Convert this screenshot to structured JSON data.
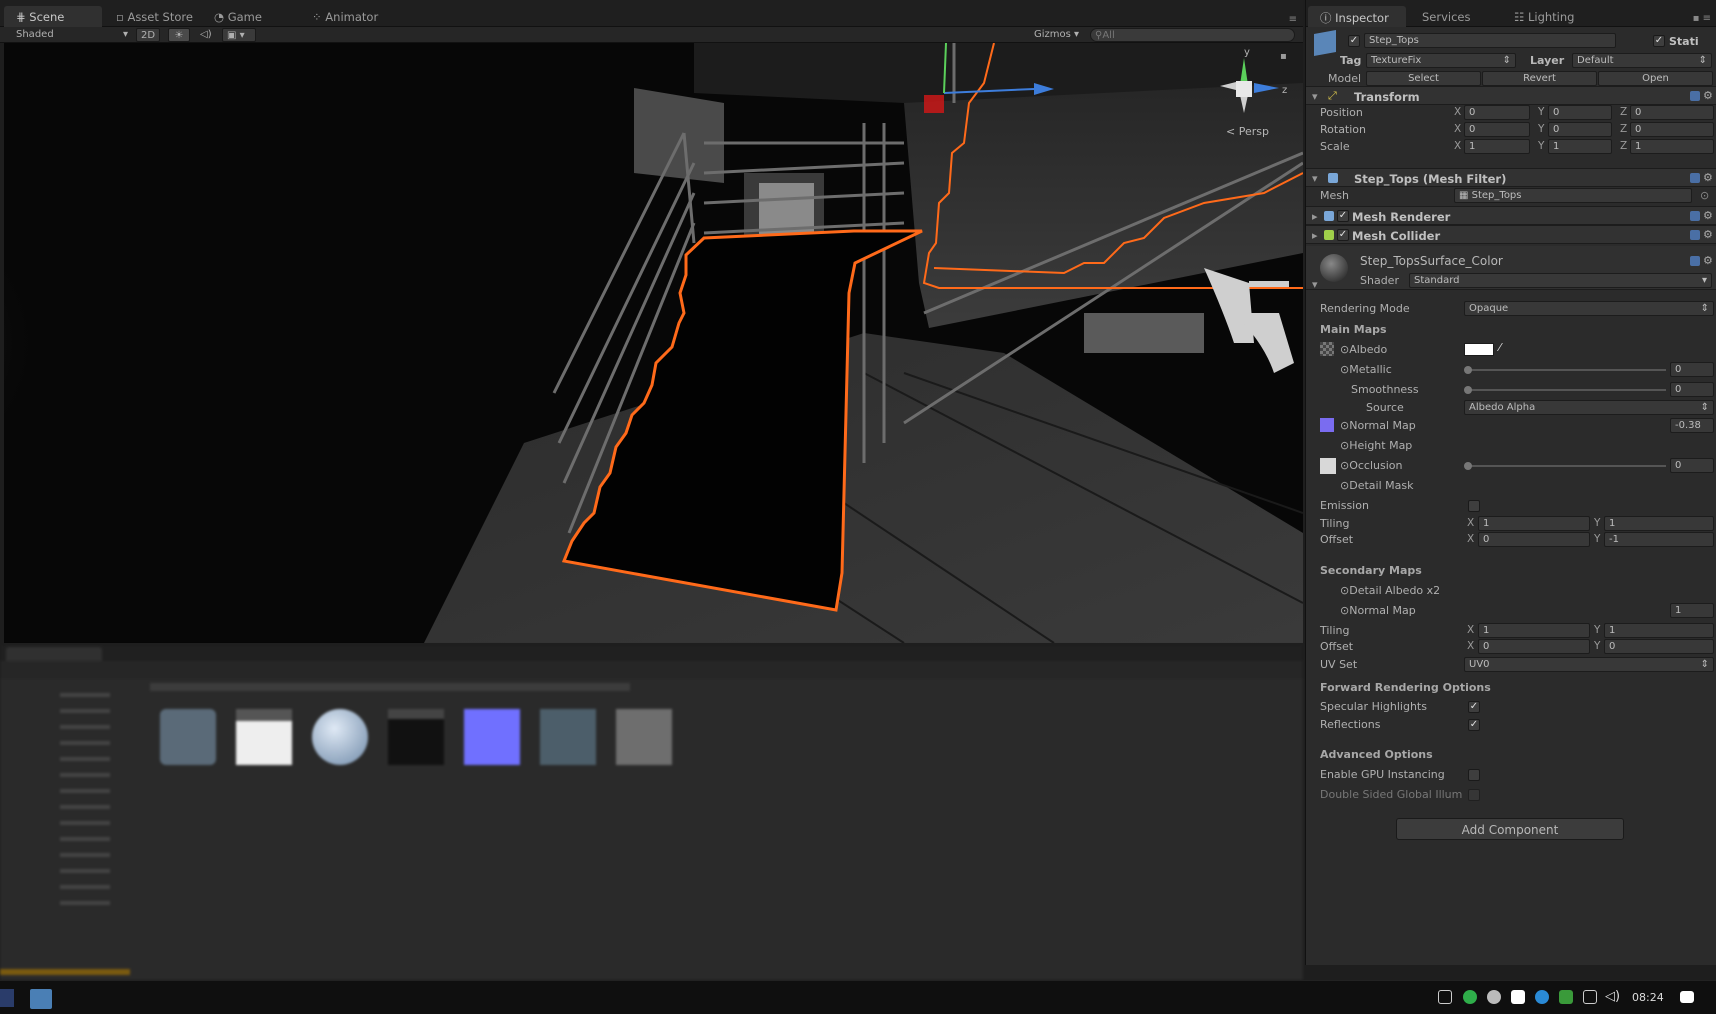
{
  "scene_tabs": {
    "scene": "Scene",
    "asset_store": "Asset Store",
    "game": "Game",
    "animator": "Animator"
  },
  "scene_toolbar": {
    "shading": "Shaded",
    "mode_2d": "2D",
    "gizmos": "Gizmos",
    "search_placeholder": "All"
  },
  "gizmo": {
    "y": "y",
    "z": "z",
    "projection": "Persp"
  },
  "inspector": {
    "tabs": {
      "inspector": "Inspector",
      "services": "Services",
      "lighting": "Lighting"
    },
    "object_name": "Step_Tops",
    "static_label": "Stati",
    "tag_label": "Tag",
    "tag_value": "TextureFix",
    "layer_label": "Layer",
    "layer_value": "Default",
    "model_label": "Model",
    "model_buttons": {
      "select": "Select",
      "revert": "Revert",
      "open": "Open"
    },
    "transform": {
      "title": "Transform",
      "position_label": "Position",
      "rotation_label": "Rotation",
      "scale_label": "Scale",
      "position": {
        "x": "0",
        "y": "0",
        "z": "0"
      },
      "rotation": {
        "x": "0",
        "y": "0",
        "z": "0"
      },
      "scale": {
        "x": "1",
        "y": "1",
        "z": "1"
      }
    },
    "mesh_filter": {
      "title": "Step_Tops (Mesh Filter)",
      "mesh_label": "Mesh",
      "mesh_value": "Step_Tops"
    },
    "mesh_renderer": "Mesh Renderer",
    "mesh_collider": "Mesh Collider",
    "material": {
      "name": "Step_TopsSurface_Color",
      "shader_label": "Shader",
      "shader_value": "Standard",
      "rendering_mode_label": "Rendering Mode",
      "rendering_mode_value": "Opaque",
      "main_maps": "Main Maps",
      "albedo": "Albedo",
      "metallic": "Metallic",
      "metallic_value": "0",
      "smoothness": "Smoothness",
      "smoothness_value": "0",
      "source": "Source",
      "source_value": "Albedo Alpha",
      "normal_map": "Normal Map",
      "normal_map_value": "-0.38",
      "height_map": "Height Map",
      "occlusion": "Occlusion",
      "occlusion_value": "0",
      "detail_mask": "Detail Mask",
      "emission": "Emission",
      "tiling": "Tiling",
      "offset": "Offset",
      "tiling_x": "1",
      "tiling_y": "1",
      "offset_x": "0",
      "offset_y": "-1",
      "secondary_maps": "Secondary Maps",
      "detail_albedo": "Detail Albedo x2",
      "normal_map2": "Normal Map",
      "normal_map2_value": "1",
      "tiling2_x": "1",
      "tiling2_y": "1",
      "offset2_x": "0",
      "offset2_y": "0",
      "uv_set": "UV Set",
      "uv_set_value": "UV0",
      "forward_rendering": "Forward Rendering Options",
      "specular_highlights": "Specular Highlights",
      "reflections": "Reflections",
      "advanced_options": "Advanced Options",
      "gpu_instancing": "Enable GPU Instancing",
      "double_sided_gi": "Double Sided Global Illum"
    },
    "add_component": "Add Component"
  },
  "taskbar": {
    "time": "08:24"
  },
  "colors": {
    "selection_outline": "#ff6a1a",
    "accent": "#4a6fa5"
  }
}
